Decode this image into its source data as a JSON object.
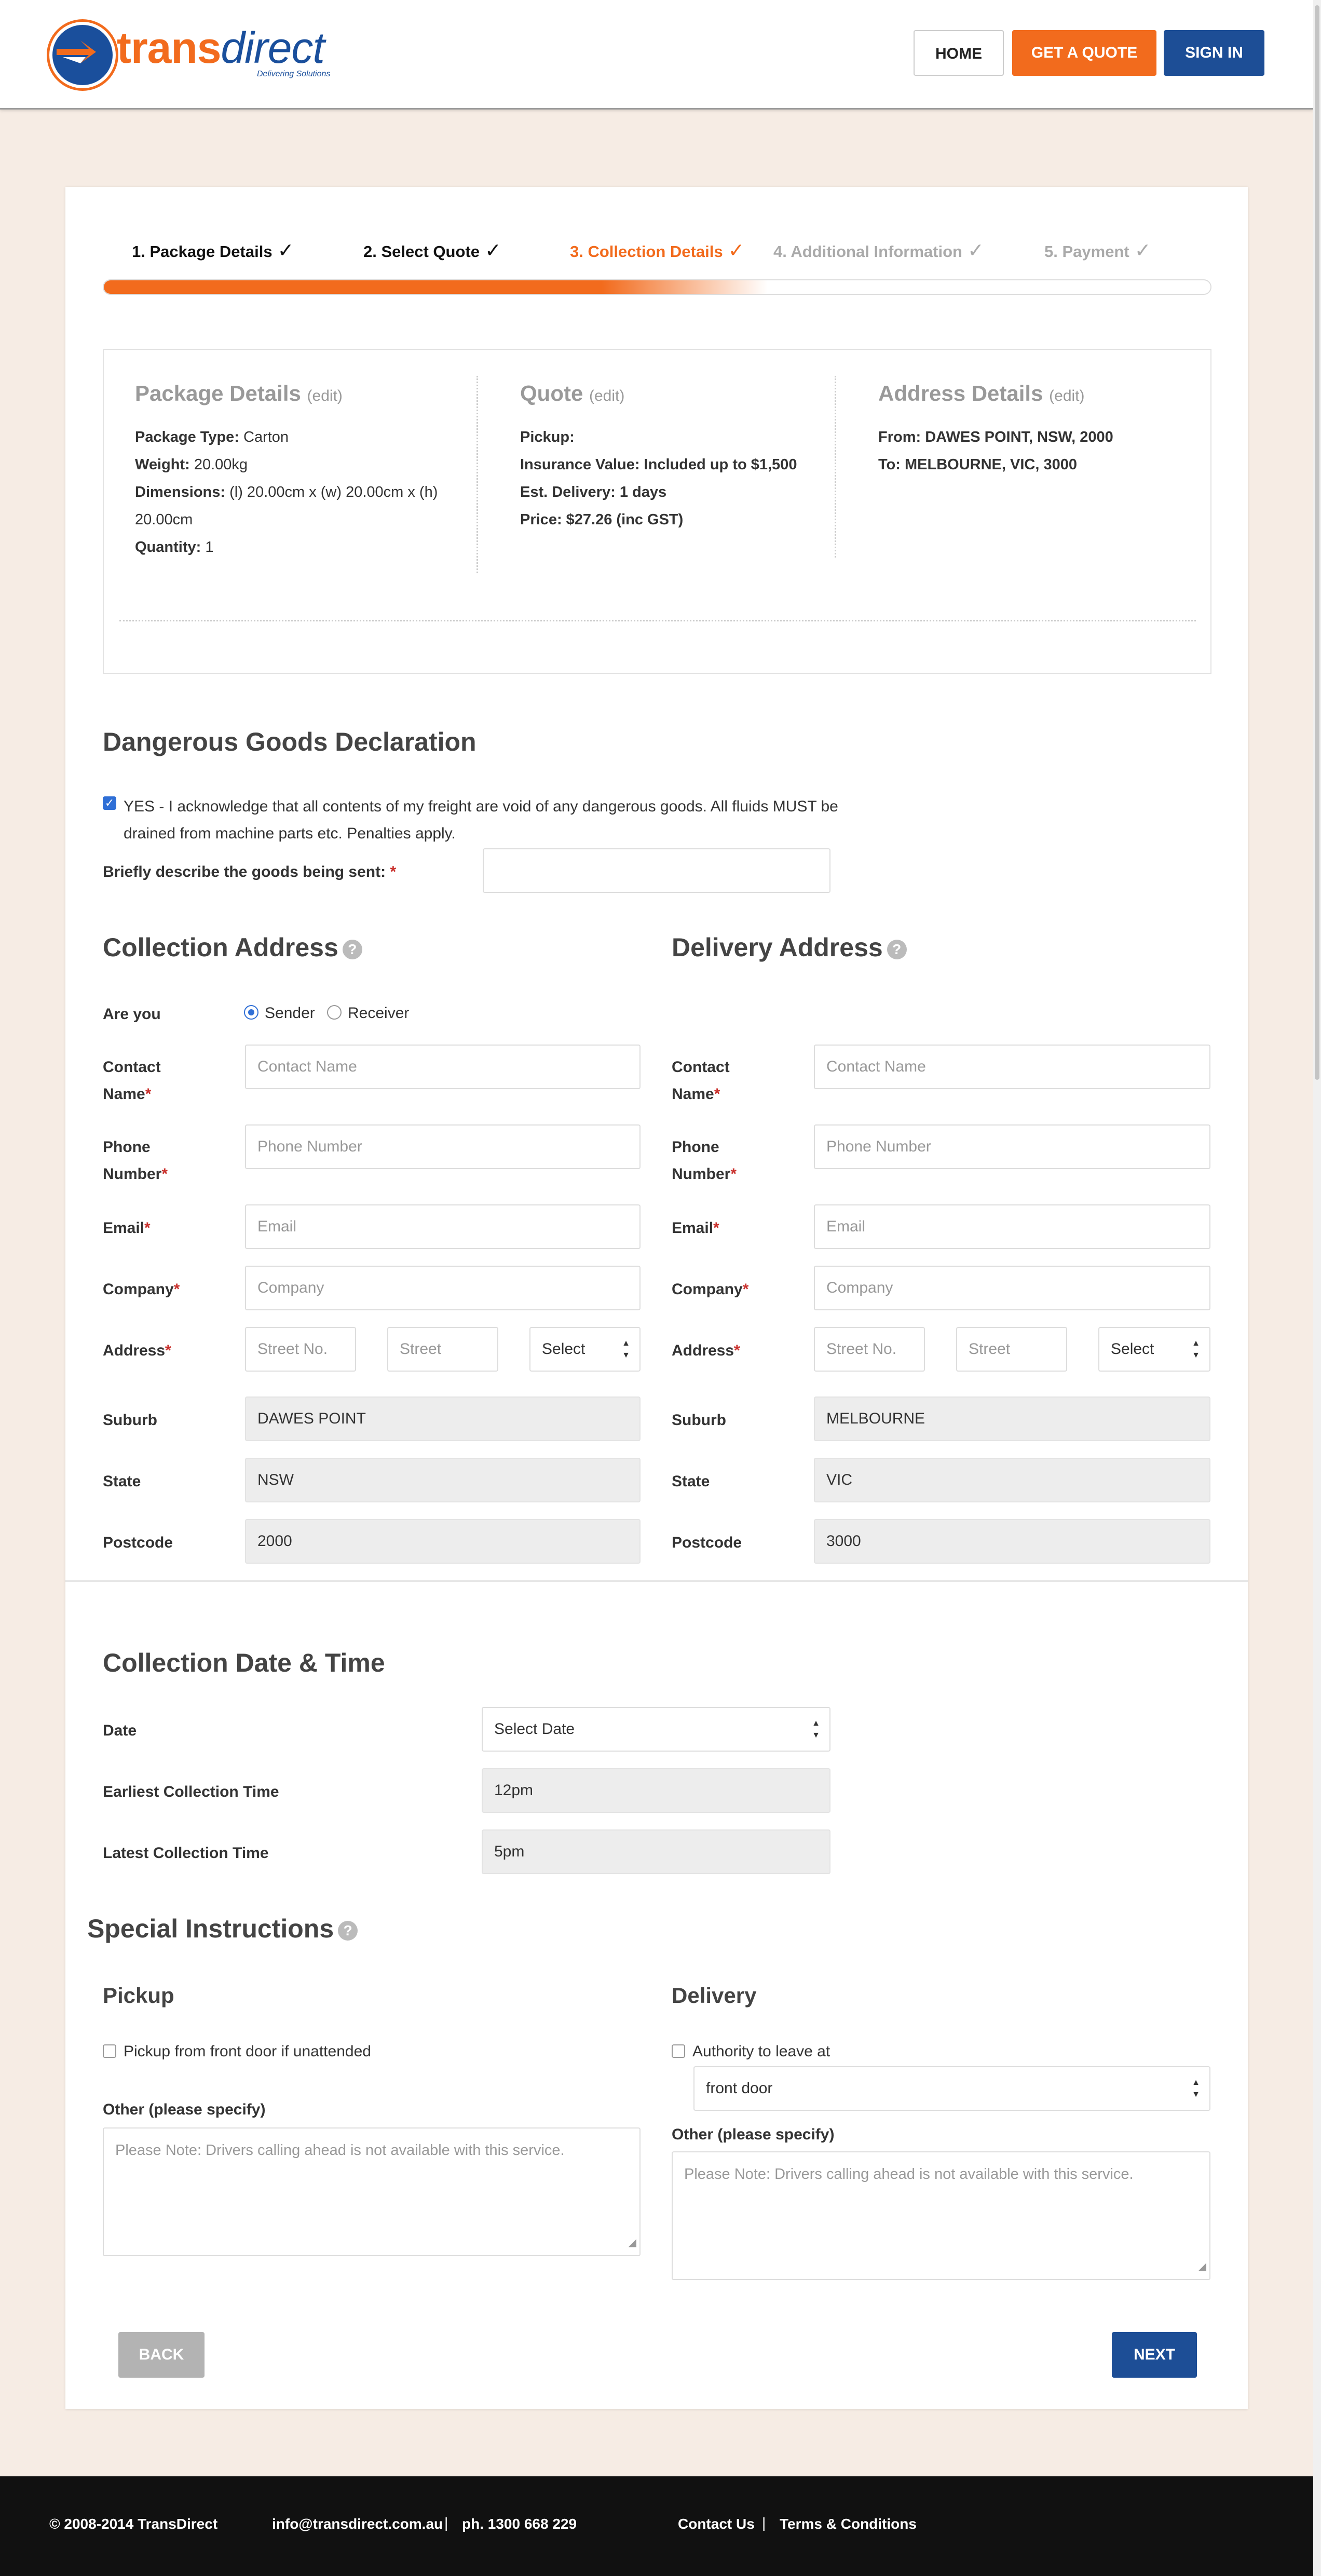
{
  "header": {
    "logo": {
      "brand_main": "trans",
      "brand_light": "direct",
      "tagline": "Delivering Solutions"
    },
    "nav": {
      "home": "HOME",
      "quote": "GET A QUOTE",
      "signin": "SIGN IN"
    }
  },
  "steps": [
    {
      "label": "1. Package Details",
      "state": "done",
      "check": "✓"
    },
    {
      "label": "2. Select Quote",
      "state": "done",
      "check": "✓"
    },
    {
      "label": "3. Collection Details",
      "state": "active",
      "check": "✓"
    },
    {
      "label": "4. Additional Information",
      "state": "todo",
      "check": "✓"
    },
    {
      "label": "5. Payment",
      "state": "todo",
      "check": "✓"
    }
  ],
  "progress_fraction": 0.6,
  "summary": {
    "package": {
      "title": "Package Details",
      "edit": "(edit)",
      "type_label": "Package Type:",
      "type_value": "Carton",
      "weight_label": "Weight:",
      "weight_value": "20.00kg",
      "dims_label": "Dimensions:",
      "dims_value": "(l) 20.00cm x (w) 20.00cm x (h)",
      "dims_value2": "20.00cm",
      "qty_label": "Quantity:",
      "qty_value": "1"
    },
    "quote": {
      "title": "Quote",
      "edit": "(edit)",
      "pickup": "Pickup:",
      "insurance": "Insurance Value: Included up to $1,500",
      "delivery": "Est. Delivery: 1 days",
      "price": "Price: $27.26 (inc GST)"
    },
    "address": {
      "title": "Address Details",
      "edit": "(edit)",
      "from": "From: DAWES POINT, NSW, 2000",
      "to": "To: MELBOURNE, VIC, 3000"
    }
  },
  "dangerous": {
    "title": "Dangerous Goods Declaration",
    "ack_line1": "YES - I acknowledge that all contents of my freight are void of any dangerous goods. All fluids MUST be",
    "ack_line2": "drained from machine parts etc. Penalties apply.",
    "describe_label": "Briefly describe the goods being sent:",
    "required": "*"
  },
  "collection": {
    "title": "Collection Address",
    "are_you": "Are you",
    "sender": "Sender",
    "receiver": "Receiver",
    "contact_1": "Contact",
    "contact_2": "Name",
    "phone_1": "Phone",
    "phone_2": "Number",
    "email": "Email",
    "company": "Company",
    "address": "Address",
    "suburb": "Suburb",
    "state": "State",
    "postcode": "Postcode",
    "ph_contact": "Contact Name",
    "ph_phone": "Phone Number",
    "ph_email": "Email",
    "ph_company": "Company",
    "ph_streetno": "Street No.",
    "ph_street": "Street",
    "select": "Select",
    "suburb_value": "DAWES POINT",
    "state_value": "NSW",
    "postcode_value": "2000"
  },
  "delivery": {
    "title": "Delivery Address",
    "contact_1": "Contact",
    "contact_2": "Name",
    "phone_1": "Phone",
    "phone_2": "Number",
    "email": "Email",
    "company": "Company",
    "address": "Address",
    "suburb": "Suburb",
    "state": "State",
    "postcode": "Postcode",
    "ph_contact": "Contact Name",
    "ph_phone": "Phone Number",
    "ph_email": "Email",
    "ph_company": "Company",
    "ph_streetno": "Street No.",
    "ph_street": "Street",
    "select": "Select",
    "suburb_value": "MELBOURNE",
    "state_value": "VIC",
    "postcode_value": "3000"
  },
  "datetime": {
    "title": "Collection Date & Time",
    "date_label": "Date",
    "date_value": "Select Date",
    "earliest_label": "Earliest Collection Time",
    "earliest_value": "12pm",
    "latest_label": "Latest Collection Time",
    "latest_value": "5pm"
  },
  "special": {
    "title": "Special Instructions",
    "pickup_title": "Pickup",
    "pickup_check": "Pickup from front door if unattended",
    "other_label": "Other (please specify)",
    "note": "Please Note: Drivers calling ahead is not available with this service.",
    "delivery_title": "Delivery",
    "delivery_check": "Authority to leave at",
    "leave_value": "front door"
  },
  "buttons": {
    "back": "BACK",
    "next": "NEXT"
  },
  "footer": {
    "copyright": "© 2008-2014 TransDirect",
    "email": "info@transdirect.com.au",
    "phone": "ph. 1300 668 229",
    "contact": "Contact Us",
    "terms": "Terms & Conditions",
    "sep": "|"
  },
  "colors": {
    "orange": "#f26b1d",
    "blue": "#1d4e96",
    "background": "#f6ece4"
  }
}
